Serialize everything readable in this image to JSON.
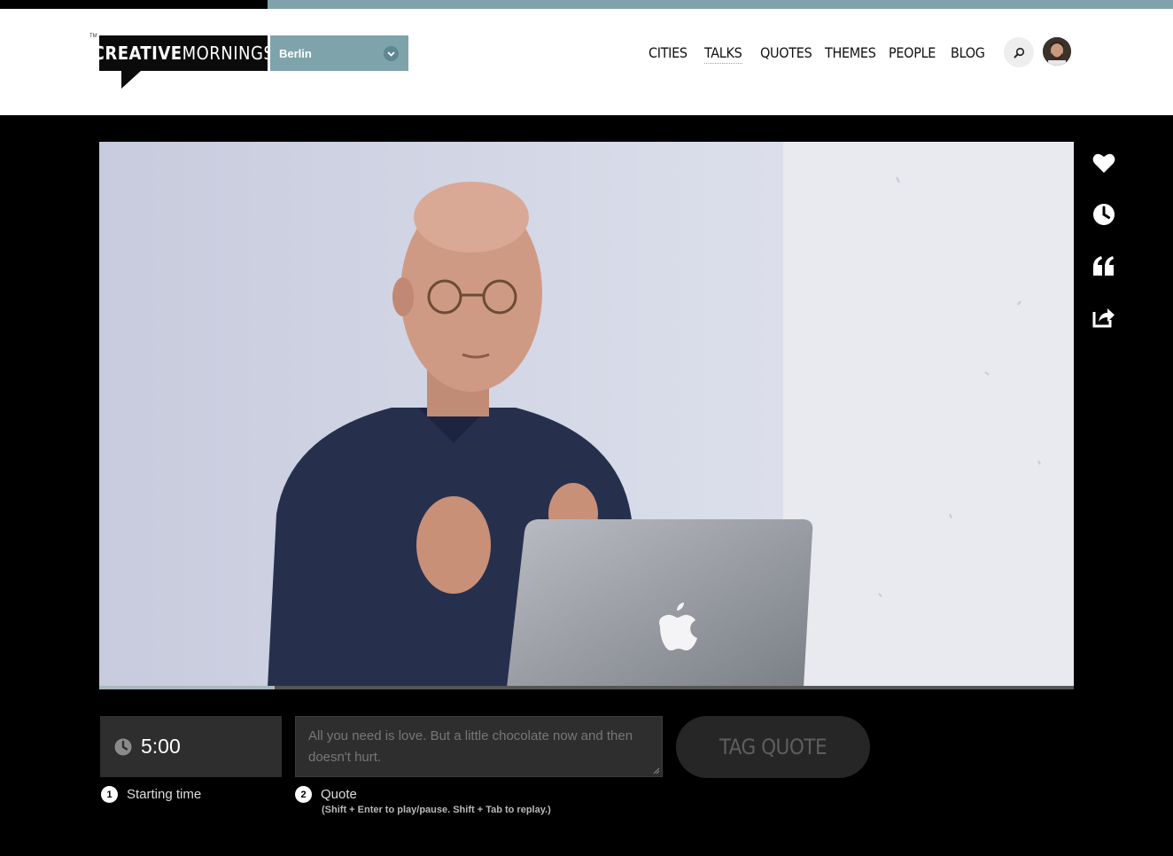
{
  "brand": {
    "logo_bold": "CREATIVE",
    "logo_light": "MORNINGS",
    "tm": "TM",
    "accent_color": "#7fa3ab"
  },
  "city_select": {
    "value": "Berlin",
    "chevron_icon": "chevron-down-icon"
  },
  "nav": {
    "items": [
      {
        "label": "CITIES"
      },
      {
        "label": "TALKS",
        "active": true
      },
      {
        "label": "QUOTES"
      },
      {
        "label": "THEMES"
      },
      {
        "label": "PEOPLE"
      },
      {
        "label": "BLOG"
      }
    ],
    "search_icon": "search-icon",
    "avatar_icon": "avatar"
  },
  "video": {
    "progress_fraction": 0.18
  },
  "side_actions": [
    {
      "icon": "heart-icon"
    },
    {
      "icon": "clock-icon"
    },
    {
      "icon": "quote-icon"
    },
    {
      "icon": "share-icon"
    }
  ],
  "tagger": {
    "time_value": "5:00",
    "time_icon": "clock-icon",
    "quote_placeholder": "All you need is love. But a little chocolate now and then doesn't hurt.",
    "tag_button_label": "TAG QUOTE",
    "steps": [
      {
        "num": "1",
        "label": "Starting time"
      },
      {
        "num": "2",
        "label": "Quote"
      }
    ],
    "hint": "(Shift + Enter to play/pause. Shift + Tab to replay.)"
  }
}
